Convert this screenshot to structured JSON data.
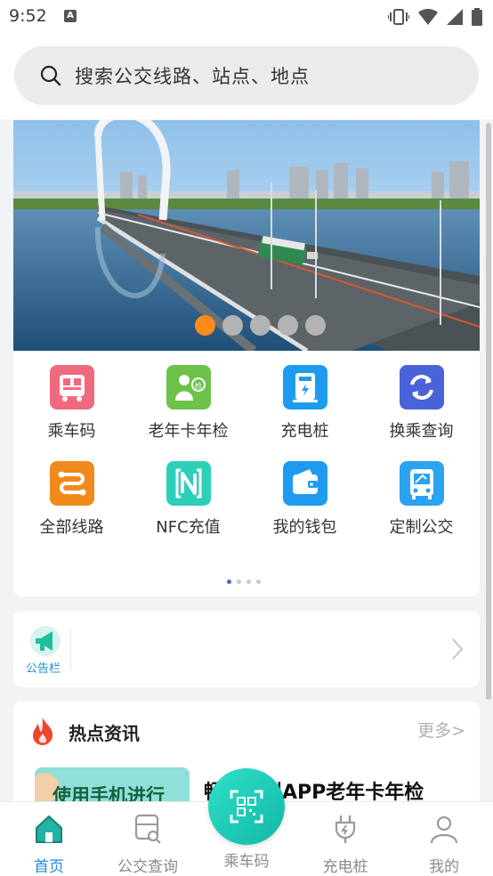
{
  "status_bar": {
    "time": "9:52",
    "notification_badge": "A"
  },
  "search": {
    "placeholder": "搜索公交线路、站点、地点"
  },
  "banner": {
    "slide_count": 5,
    "active_slide": 1
  },
  "grid": {
    "items": [
      {
        "label": "乘车码",
        "icon": "qr-bus-icon",
        "color": "#f06a7f"
      },
      {
        "label": "老年卡年检",
        "icon": "elderly-card-icon",
        "color": "#6cc24a"
      },
      {
        "label": "充电桩",
        "icon": "charging-pile-icon",
        "color": "#1e9bef"
      },
      {
        "label": "换乘查询",
        "icon": "transfer-icon",
        "color": "#4a63d8"
      },
      {
        "label": "全部线路",
        "icon": "all-routes-icon",
        "color": "#f08a1c"
      },
      {
        "label": "NFC充值",
        "icon": "nfc-icon",
        "color": "#2ccfb8"
      },
      {
        "label": "我的钱包",
        "icon": "wallet-icon",
        "color": "#1e9bef"
      },
      {
        "label": "定制公交",
        "icon": "custom-bus-icon",
        "color": "#2aa3f0"
      }
    ],
    "page_count": 4,
    "active_page": 1
  },
  "notice": {
    "label": "公告栏"
  },
  "news": {
    "title": "热点资讯",
    "more": "更多>",
    "thumb_text": "使用手机进行",
    "headline": "畅行徐州APP老年卡年检"
  },
  "tabbar": {
    "tabs": [
      {
        "label": "首页",
        "icon": "home-icon",
        "active": true
      },
      {
        "label": "公交查询",
        "icon": "bus-search-icon",
        "active": false
      },
      {
        "label": "乘车码",
        "icon": "scan-qr-icon",
        "active": false
      },
      {
        "label": "充电桩",
        "icon": "plug-icon",
        "active": false
      },
      {
        "label": "我的",
        "icon": "user-icon",
        "active": false
      }
    ]
  },
  "colors": {
    "accent": "#1b8ad6",
    "active_dot": "#ff8a1c",
    "fab": "#1ec9b4"
  }
}
